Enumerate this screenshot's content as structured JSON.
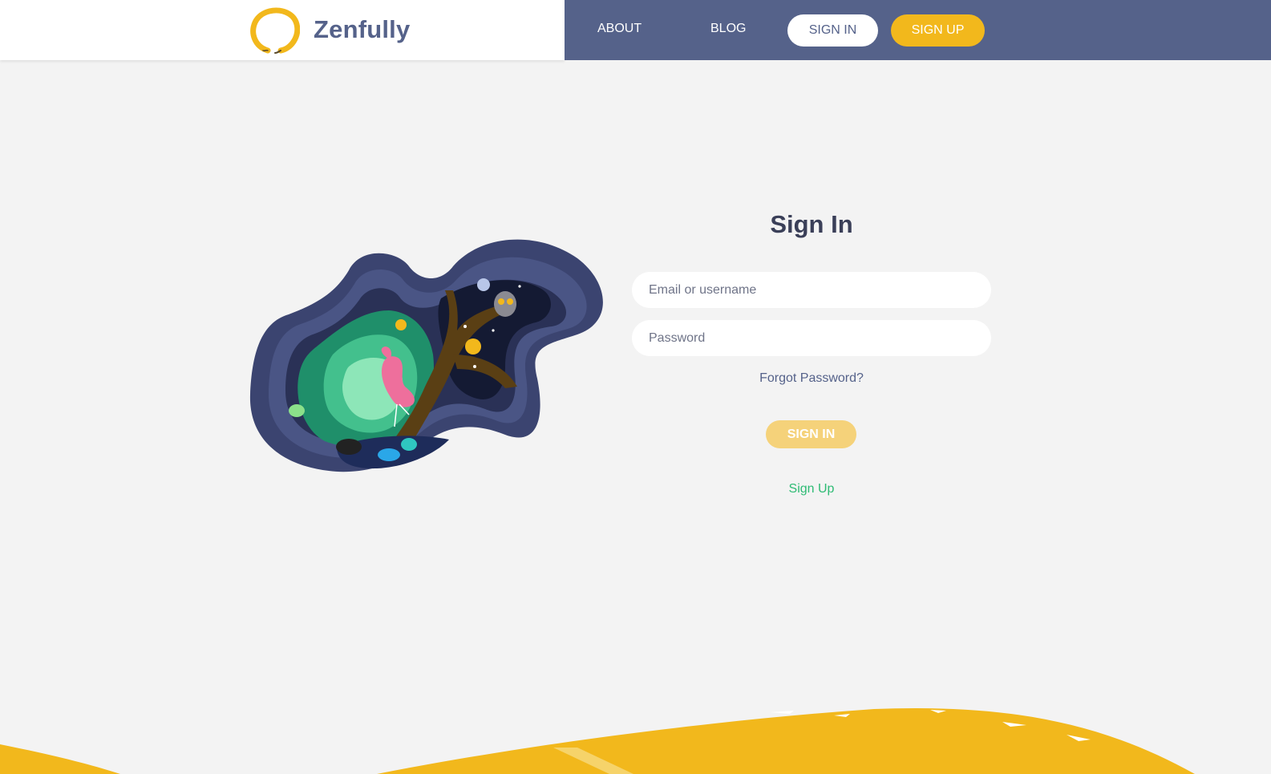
{
  "brand": {
    "name": "Zenfully",
    "logo_icon": "enso-circle-icon"
  },
  "nav": {
    "about": "ABOUT",
    "blog": "BLOG",
    "sign_in": "SIGN IN",
    "sign_up": "SIGN UP"
  },
  "form": {
    "title": "Sign In",
    "email_placeholder": "Email or username",
    "password_placeholder": "Password",
    "forgot": "Forgot Password?",
    "submit": "SIGN IN",
    "signup_link": "Sign Up"
  },
  "colors": {
    "nav_bg": "#55628a",
    "accent_yellow": "#f2b81c",
    "page_bg": "#f3f3f3",
    "link_green": "#2ebb74",
    "title": "#3a3f58"
  },
  "illustration": {
    "icon": "papercut-forest-illustration"
  }
}
